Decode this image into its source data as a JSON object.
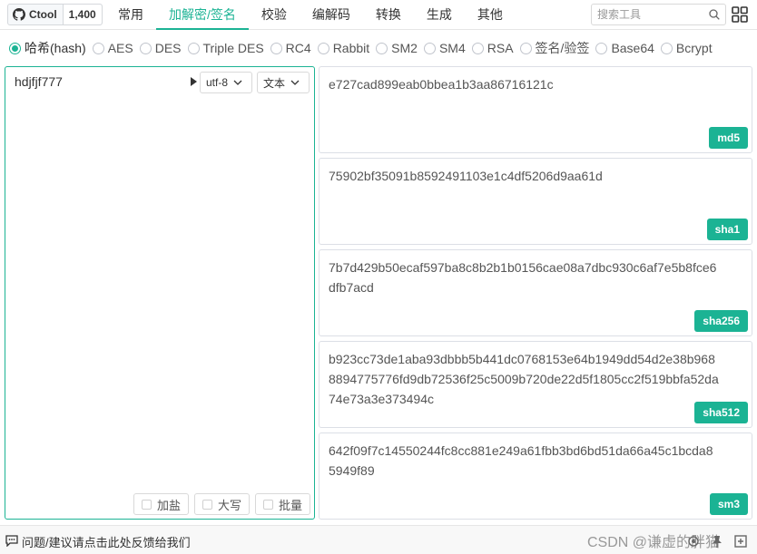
{
  "header": {
    "github": {
      "name": "Ctool",
      "stars": "1,400"
    },
    "tabs": [
      {
        "label": "常用",
        "active": false
      },
      {
        "label": "加解密/签名",
        "active": true
      },
      {
        "label": "校验",
        "active": false
      },
      {
        "label": "编解码",
        "active": false
      },
      {
        "label": "转换",
        "active": false
      },
      {
        "label": "生成",
        "active": false
      },
      {
        "label": "其他",
        "active": false
      }
    ],
    "search_placeholder": "搜索工具"
  },
  "algorithms": [
    {
      "label": "哈希(hash)",
      "checked": true
    },
    {
      "label": "AES",
      "checked": false
    },
    {
      "label": "DES",
      "checked": false
    },
    {
      "label": "Triple DES",
      "checked": false
    },
    {
      "label": "RC4",
      "checked": false
    },
    {
      "label": "Rabbit",
      "checked": false
    },
    {
      "label": "SM2",
      "checked": false
    },
    {
      "label": "SM4",
      "checked": false
    },
    {
      "label": "RSA",
      "checked": false
    },
    {
      "label": "签名/验签",
      "checked": false
    },
    {
      "label": "Base64",
      "checked": false
    },
    {
      "label": "Bcrypt",
      "checked": false
    }
  ],
  "input": {
    "value": "hdjfjf777",
    "encoding": "utf-8",
    "type": "文本",
    "options": {
      "salt": "加盐",
      "uppercase": "大写",
      "batch": "批量"
    }
  },
  "outputs": [
    {
      "value": "e727cad899eab0bbea1b3aa86716121c",
      "label": "md5"
    },
    {
      "value": "75902bf35091b8592491103e1c4df5206d9aa61d",
      "label": "sha1"
    },
    {
      "value": "7b7d429b50ecaf597ba8c8b2b1b0156cae08a7dbc930c6af7e5b8fce6dfb7acd",
      "label": "sha256"
    },
    {
      "value": "b923cc73de1aba93dbbb5b441dc0768153e64b1949dd54d2e38b9688894775776fd9db72536f25c5009b720de22d5f1805cc2f519bbfa52da74e73a3e373494c",
      "label": "sha512"
    },
    {
      "value": "642f09f7c14550244fc8cc881e249a61fbb3bd6bd51da66a45c1bcda85949f89",
      "label": "sm3"
    }
  ],
  "footer": {
    "feedback": "问题/建议请点击此处反馈给我们",
    "watermark": "CSDN @谦虚的胖猫"
  },
  "colors": {
    "accent": "#1bb394",
    "border": "#dcdfe6"
  }
}
